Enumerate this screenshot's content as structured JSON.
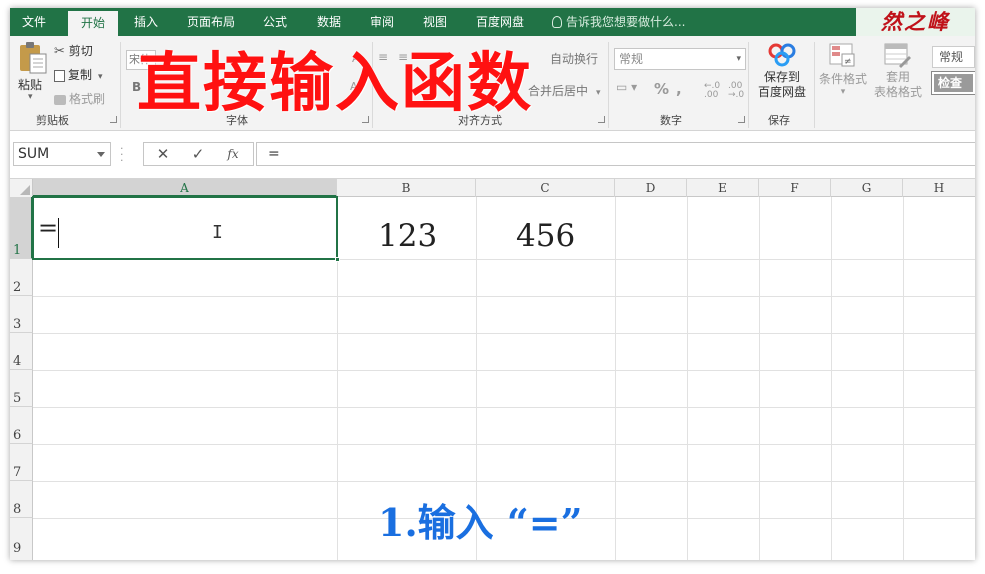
{
  "tabs": [
    "文件",
    "开始",
    "插入",
    "页面布局",
    "公式",
    "数据",
    "审阅",
    "视图",
    "百度网盘"
  ],
  "active_tab_index": 1,
  "tell_me": "告诉我您想要做什么...",
  "signature": "然之峰",
  "ribbon": {
    "clipboard": {
      "paste": "粘贴",
      "cut": "剪切",
      "copy": "复制",
      "format_painter": "格式刷",
      "group_label": "剪贴板"
    },
    "font": {
      "font_name": "宋体",
      "group_label": "字体"
    },
    "alignment": {
      "wrap": "自动换行",
      "merge": "合并后居中",
      "group_label": "对齐方式"
    },
    "number": {
      "format": "常规",
      "percent": "%",
      "comma": ",",
      "group_label": "数字"
    },
    "save": {
      "button": "保存到\n百度网盘",
      "line1": "保存到",
      "line2": "百度网盘",
      "group_label": "保存"
    },
    "styles": {
      "conditional": "条件格式",
      "table_line1": "套用",
      "table_line2": "表格格式",
      "normal": "常规",
      "check": "检查"
    }
  },
  "overlay_title": "直接输入函数",
  "formula_bar": {
    "name_box": "SUM",
    "cancel": "✕",
    "enter": "✓",
    "fx": "fx",
    "content": "="
  },
  "columns": [
    "A",
    "B",
    "C",
    "D",
    "E",
    "F",
    "G",
    "H"
  ],
  "selected_column": "A",
  "rows": [
    "1",
    "2",
    "3",
    "4",
    "5",
    "6",
    "7",
    "8",
    "9"
  ],
  "selected_row": "1",
  "cells": {
    "A1": "=",
    "B1": "123",
    "C1": "456"
  },
  "step_caption": "1.输入 “=”",
  "colors": {
    "excel_green": "#217346",
    "title_red": "#ff1111",
    "caption_blue": "#1a6fe0"
  }
}
